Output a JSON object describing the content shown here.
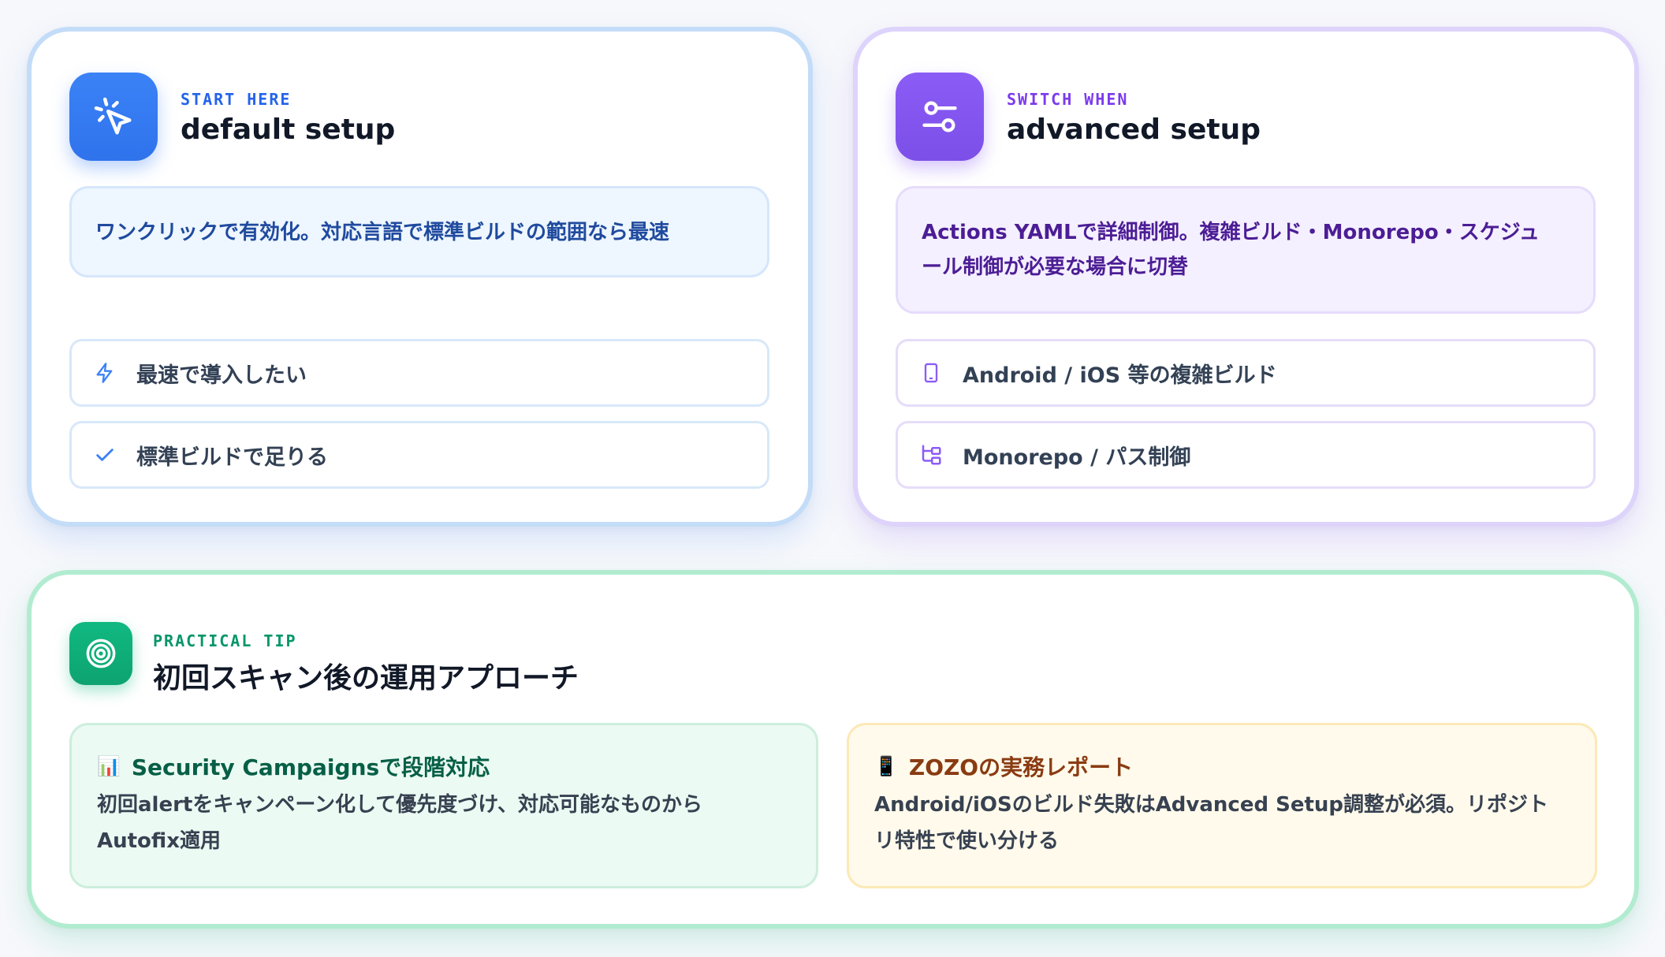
{
  "default_card": {
    "eyebrow": "START HERE",
    "title": "default setup",
    "icon": "cursor-click-icon",
    "description": "ワンクリックで有効化。対応言語で標準ビルドの範囲なら最速",
    "items": [
      {
        "icon": "lightning-icon",
        "label": "最速で導入したい"
      },
      {
        "icon": "check-icon",
        "label": "標準ビルドで足りる"
      }
    ],
    "accent": "#3b82f6"
  },
  "advanced_card": {
    "eyebrow": "SWITCH WHEN",
    "title": "advanced setup",
    "icon": "sliders-icon",
    "description_line1": "Actions YAMLで詳細制御。複雑ビルド・Monorepo・スケジュ",
    "description_line2": "ール制御が必要な場合に切替",
    "items": [
      {
        "icon": "phone-icon",
        "label": "Android / iOS 等の複雑ビルド"
      },
      {
        "icon": "folder-tree-icon",
        "label": "Monorepo / パス制御"
      }
    ],
    "accent": "#8b5cf6"
  },
  "tip_card": {
    "eyebrow": "PRACTICAL TIP",
    "title": "初回スキャン後の運用アプローチ",
    "icon": "target-icon",
    "accent": "#10b981",
    "boxes": [
      {
        "emoji": "📊",
        "heading": "Security Campaignsで段階対応",
        "body_line1": "初回alertをキャンペーン化して優先度づけ、対応可能なものから",
        "body_line2": "Autofix適用"
      },
      {
        "emoji": "📱",
        "heading": "ZOZOの実務レポート",
        "body_line1": "Android/iOSのビルド失敗はAdvanced Setup調整が必須。リポジト",
        "body_line2": "リ特性で使い分ける"
      }
    ]
  }
}
